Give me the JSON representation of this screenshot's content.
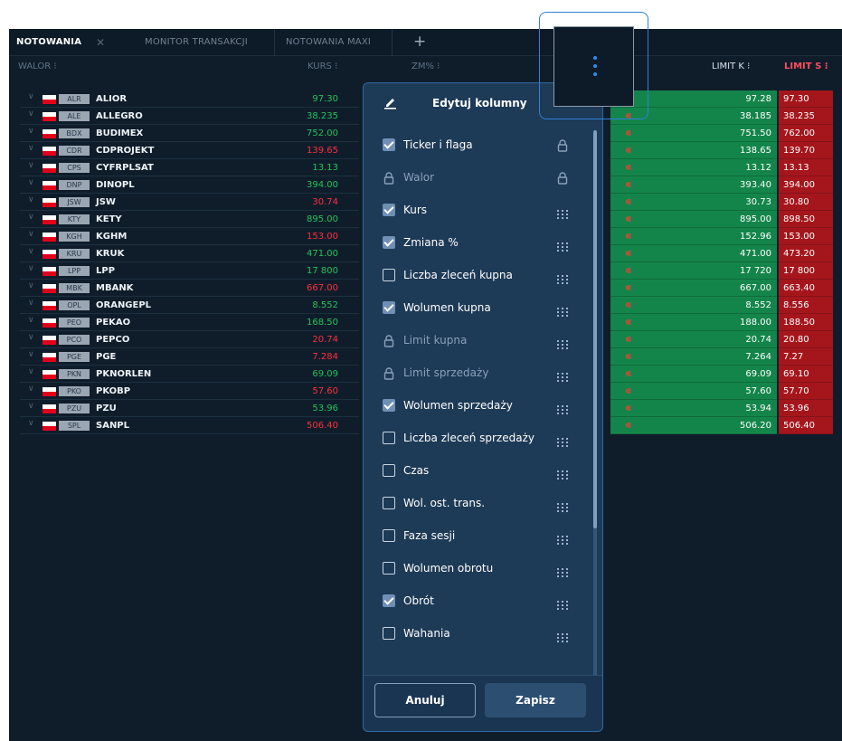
{
  "tabs": [
    {
      "label": "NOTOWANIA",
      "active": true
    },
    {
      "label": "MONITOR TRANSAKCJI",
      "active": false
    },
    {
      "label": "NOTOWANIA MAXI",
      "active": false
    }
  ],
  "tab_close": "✕",
  "tab_add": "+",
  "headers": {
    "walor": "WALOR ⁝",
    "kurs": "KURS ⁝",
    "zm": "ZM% ⁝",
    "limit_k": "LIMIT K ⁝",
    "limit_s": "LIMIT S ⁝"
  },
  "rows": [
    {
      "ticker": "ALR",
      "name": "ALIOR",
      "kurs": "97.30",
      "dir": "up",
      "limit_k": "97.28",
      "limit_s": "97.30"
    },
    {
      "ticker": "ALE",
      "name": "ALLEGRO",
      "kurs": "38.235",
      "dir": "up",
      "limit_k": "38.185",
      "limit_s": "38.235"
    },
    {
      "ticker": "BDX",
      "name": "BUDIMEX",
      "kurs": "752.00",
      "dir": "up",
      "limit_k": "751.50",
      "limit_s": "762.00"
    },
    {
      "ticker": "CDR",
      "name": "CDPROJEKT",
      "kurs": "139.65",
      "dir": "down",
      "limit_k": "138.65",
      "limit_s": "139.70"
    },
    {
      "ticker": "CPS",
      "name": "CYFRPLSAT",
      "kurs": "13.13",
      "dir": "up",
      "limit_k": "13.12",
      "limit_s": "13.13"
    },
    {
      "ticker": "DNP",
      "name": "DINOPL",
      "kurs": "394.00",
      "dir": "up",
      "limit_k": "393.40",
      "limit_s": "394.00"
    },
    {
      "ticker": "JSW",
      "name": "JSW",
      "kurs": "30.74",
      "dir": "down",
      "limit_k": "30.73",
      "limit_s": "30.80"
    },
    {
      "ticker": "KTY",
      "name": "KETY",
      "kurs": "895.00",
      "dir": "up",
      "limit_k": "895.00",
      "limit_s": "898.50"
    },
    {
      "ticker": "KGH",
      "name": "KGHM",
      "kurs": "153.00",
      "dir": "down",
      "limit_k": "152.96",
      "limit_s": "153.00"
    },
    {
      "ticker": "KRU",
      "name": "KRUK",
      "kurs": "471.00",
      "dir": "up",
      "limit_k": "471.00",
      "limit_s": "473.20"
    },
    {
      "ticker": "LPP",
      "name": "LPP",
      "kurs": "17 800",
      "dir": "up",
      "limit_k": "17 720",
      "limit_s": "17 800"
    },
    {
      "ticker": "MBK",
      "name": "MBANK",
      "kurs": "667.00",
      "dir": "down",
      "limit_k": "667.00",
      "limit_s": "663.40"
    },
    {
      "ticker": "OPL",
      "name": "ORANGEPL",
      "kurs": "8.552",
      "dir": "up",
      "limit_k": "8.552",
      "limit_s": "8.556"
    },
    {
      "ticker": "PEO",
      "name": "PEKAO",
      "kurs": "168.50",
      "dir": "up",
      "limit_k": "188.00",
      "limit_s": "188.50"
    },
    {
      "ticker": "PCO",
      "name": "PEPCO",
      "kurs": "20.74",
      "dir": "down",
      "limit_k": "20.74",
      "limit_s": "20.80"
    },
    {
      "ticker": "PGE",
      "name": "PGE",
      "kurs": "7.284",
      "dir": "down",
      "limit_k": "7.264",
      "limit_s": "7.27"
    },
    {
      "ticker": "PKN",
      "name": "PKNORLEN",
      "kurs": "69.09",
      "dir": "up",
      "limit_k": "69.09",
      "limit_s": "69.10"
    },
    {
      "ticker": "PKO",
      "name": "PKOBP",
      "kurs": "57.60",
      "dir": "down",
      "limit_k": "57.60",
      "limit_s": "57.70"
    },
    {
      "ticker": "PZU",
      "name": "PZU",
      "kurs": "53.96",
      "dir": "up",
      "limit_k": "53.94",
      "limit_s": "53.96"
    },
    {
      "ticker": "SPL",
      "name": "SANPL",
      "kurs": "506.40",
      "dir": "down",
      "limit_k": "506.20",
      "limit_s": "506.40"
    }
  ],
  "menu": {
    "title": "Edytuj kolumny",
    "items": [
      {
        "label": "Ticker i flaga",
        "state": "checked",
        "right": "lock"
      },
      {
        "label": "Walor",
        "state": "locked",
        "right": "lock"
      },
      {
        "label": "Kurs",
        "state": "checked",
        "right": "grip"
      },
      {
        "label": "Zmiana %",
        "state": "checked",
        "right": "grip"
      },
      {
        "label": "Liczba zleceń kupna",
        "state": "unchecked",
        "right": "grip"
      },
      {
        "label": "Wolumen kupna",
        "state": "checked",
        "right": "grip"
      },
      {
        "label": "Limit kupna",
        "state": "locked",
        "right": "grip"
      },
      {
        "label": "Limit sprzedaży",
        "state": "locked",
        "right": "grip"
      },
      {
        "label": "Wolumen sprzedaży",
        "state": "checked",
        "right": "grip"
      },
      {
        "label": "Liczba zleceń sprzedaży",
        "state": "unchecked",
        "right": "grip"
      },
      {
        "label": "Czas",
        "state": "unchecked",
        "right": "grip"
      },
      {
        "label": "Wol. ost. trans.",
        "state": "unchecked",
        "right": "grip"
      },
      {
        "label": "Faza sesji",
        "state": "unchecked",
        "right": "grip"
      },
      {
        "label": "Wolumen obrotu",
        "state": "unchecked",
        "right": "grip"
      },
      {
        "label": "Obrót",
        "state": "checked",
        "right": "grip"
      },
      {
        "label": "Wahania",
        "state": "unchecked",
        "right": "grip"
      }
    ],
    "cancel": "Anuluj",
    "save": "Zapisz"
  },
  "colors": {
    "up": "#23c25a",
    "down": "#ff2e3d",
    "buy_bg": "#14854a",
    "sell_bg": "#a5161c",
    "accent": "#2a8df0"
  }
}
